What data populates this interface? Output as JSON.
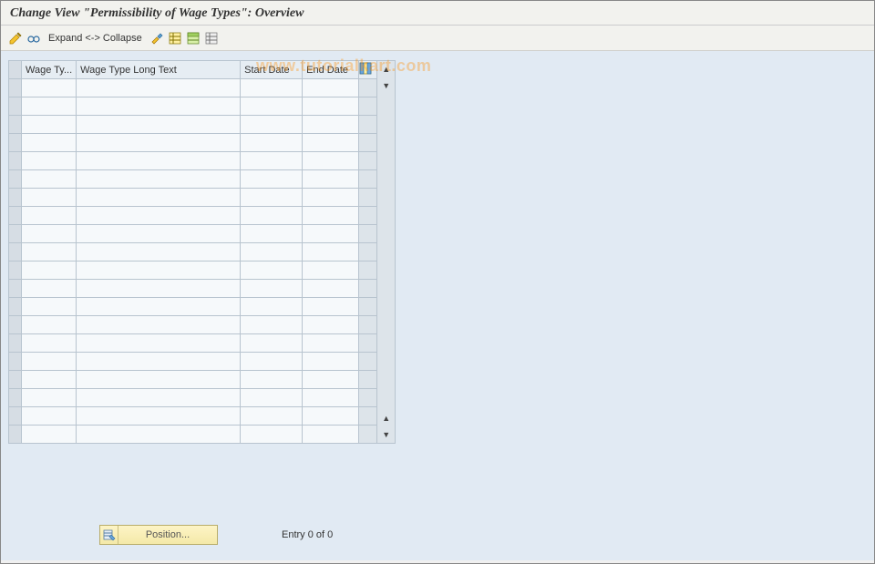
{
  "title": "Change View \"Permissibility of Wage Types\": Overview",
  "toolbar": {
    "expand_collapse": "Expand <-> Collapse"
  },
  "watermark": "www.tutorialkart.com",
  "table": {
    "headers": {
      "wage_type": "Wage Ty...",
      "long_text": "Wage Type Long Text",
      "start_date": "Start Date",
      "end_date": "End Date"
    },
    "rows_visible": 20
  },
  "footer": {
    "position_label": "Position...",
    "entry_text": "Entry 0 of 0"
  }
}
